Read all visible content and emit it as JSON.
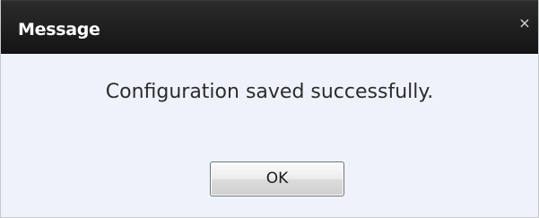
{
  "dialog": {
    "title": "Message",
    "close_glyph": "×",
    "close_icon": "close-icon",
    "message": "Configuration saved successfully.",
    "ok_label": "OK"
  },
  "colors": {
    "titlebar": "#1e1e1e",
    "body_background": "#eef3fb",
    "title_text": "#ffffff",
    "message_text": "#2c2c2c"
  }
}
